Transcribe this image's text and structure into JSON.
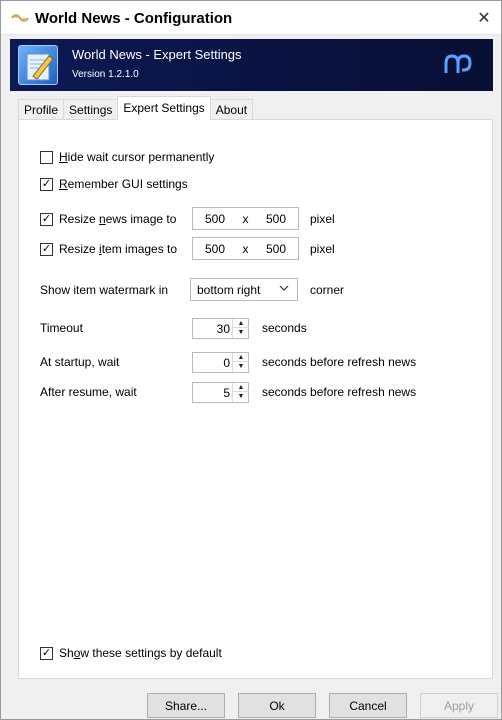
{
  "window": {
    "title": "World News - Configuration",
    "close_glyph": "✕"
  },
  "banner": {
    "title": "World News - Expert Settings",
    "version": "Version 1.2.1.0",
    "logo_icon": "mp-logo-icon",
    "bg_color": "#0c1a55"
  },
  "tabs": [
    {
      "label": "Profile",
      "active": false
    },
    {
      "label": "Settings",
      "active": false
    },
    {
      "label": "Expert Settings",
      "active": true
    },
    {
      "label": "About",
      "active": false
    }
  ],
  "options": {
    "hide_wait_cursor": {
      "prefix": "",
      "underline": "H",
      "suffix": "ide wait cursor permanently",
      "checked": false
    },
    "remember_gui": {
      "prefix": "",
      "underline": "R",
      "suffix": "emember GUI settings",
      "checked": true
    },
    "resize_news": {
      "prefix": "Resize ",
      "underline": "n",
      "suffix": "ews image to",
      "checked": true,
      "w": "500",
      "x": "x",
      "h": "500",
      "unit": "pixel"
    },
    "resize_item": {
      "prefix": "Resize ",
      "underline": "i",
      "suffix": "tem images to",
      "checked": true,
      "w": "500",
      "x": "x",
      "h": "500",
      "unit": "pixel"
    },
    "watermark": {
      "label": "Show item watermark in",
      "value": "bottom right",
      "suffix": "corner"
    },
    "timeout": {
      "label": "Timeout",
      "value": "30",
      "unit": "seconds"
    },
    "startup": {
      "label": "At startup, wait",
      "value": "0",
      "unit": "seconds before refresh news"
    },
    "resume": {
      "label": "After resume, wait",
      "value": "5",
      "unit": "seconds before refresh news"
    },
    "show_default": {
      "prefix": "Sh",
      "underline": "o",
      "suffix": "w these settings by default",
      "checked": true
    }
  },
  "check_glyph": "✓",
  "buttons": {
    "share": "Share...",
    "ok": "Ok",
    "cancel": "Cancel",
    "apply": "Apply"
  }
}
